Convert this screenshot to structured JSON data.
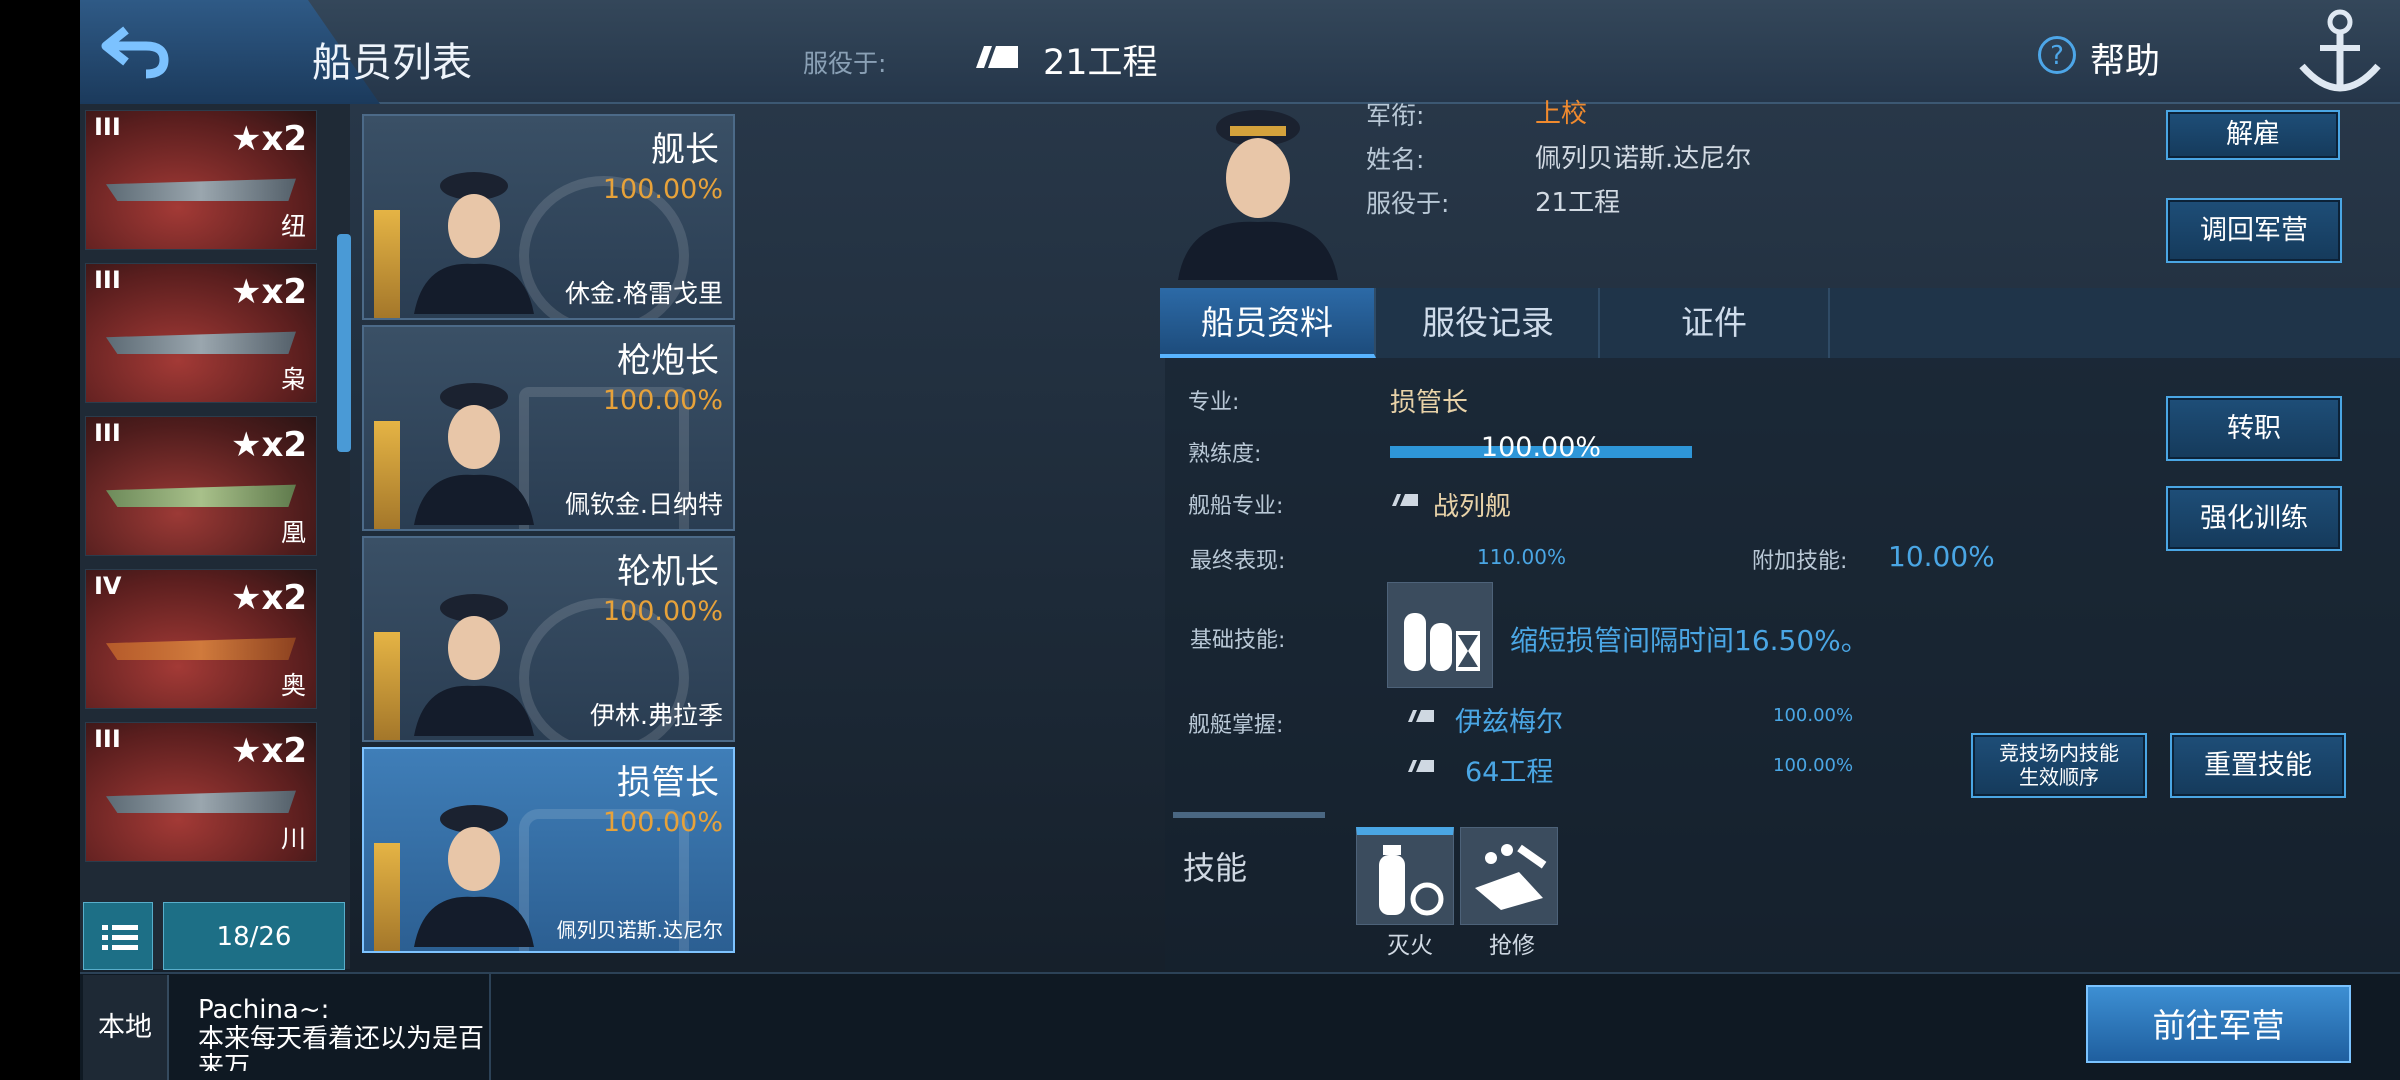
{
  "header": {
    "title": "船员列表",
    "serve_label": "服役于:",
    "serve_value": "21工程",
    "help_label": "帮助"
  },
  "ships": [
    {
      "tier": "III",
      "mult": "x2",
      "name": "纽"
    },
    {
      "tier": "III",
      "mult": "x2",
      "name": "枭"
    },
    {
      "tier": "III",
      "mult": "x2",
      "name": "凰"
    },
    {
      "tier": "IV",
      "mult": "x2",
      "name": "奥"
    },
    {
      "tier": "III",
      "mult": "x2",
      "name": "川"
    }
  ],
  "list_count": "18/26",
  "crew": [
    {
      "role": "舰长",
      "pct": "100.00%",
      "name": "休金.格雷戈里"
    },
    {
      "role": "枪炮长",
      "pct": "100.00%",
      "name": "佩钦金.日纳特"
    },
    {
      "role": "轮机长",
      "pct": "100.00%",
      "name": "伊林.弗拉季"
    },
    {
      "role": "损管长",
      "pct": "100.00%",
      "name": "佩列贝诺斯.达尼尔"
    }
  ],
  "profile": {
    "rank_label": "军衔:",
    "rank_value": "上校",
    "name_label": "姓名:",
    "name_value": "佩列贝诺斯.达尼尔",
    "serve_label": "服役于:",
    "serve_value": "21工程",
    "dismiss": "解雇",
    "recall": "调回军营"
  },
  "tabs": [
    "船员资料",
    "服役记录",
    "证件"
  ],
  "detail": {
    "spec_label": "专业:",
    "spec_value": "损管长",
    "prof_label": "熟练度:",
    "prof_value": "100.00%",
    "prof_fraction": 1.0,
    "ship_spec_label": "舰船专业:",
    "ship_spec_value": "战列舰",
    "final_label": "最终表现:",
    "final_value": "110.00%",
    "bonus_label": "附加技能:",
    "bonus_value": "10.00%",
    "base_skill_label": "基础技能:",
    "base_skill_value": "缩短损管间隔时间16.50%。",
    "mastery_label": "舰艇掌握:",
    "mastery": [
      {
        "ship": "伊兹梅尔",
        "pct": "100.00%"
      },
      {
        "ship": "64工程",
        "pct": "100.00%"
      }
    ],
    "skills_title": "技能",
    "skills": [
      {
        "label": "灭火",
        "icon": "fire-extinguisher-icon"
      },
      {
        "label": "抢修",
        "icon": "repair-icon"
      }
    ],
    "btn_transfer": "转职",
    "btn_train": "强化训练",
    "btn_order": "竞技场内技能生效顺序",
    "btn_reset": "重置技能"
  },
  "footer": {
    "channel": "本地",
    "chat_name": "Pachina~:",
    "chat_msg": "本来每天看着还以为是百来万",
    "goto": "前往军营"
  }
}
